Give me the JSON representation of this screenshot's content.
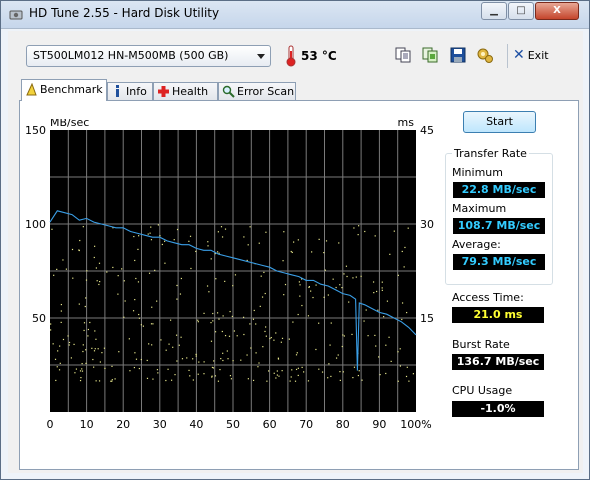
{
  "window": {
    "title": "HD Tune 2.55 - Hard Disk Utility",
    "controls": {
      "minimize": "▁",
      "maximize": "□",
      "close": "X"
    }
  },
  "toolbar": {
    "drive": "ST500LM012 HN-M500MB (500 GB)",
    "temperature": "53 °C",
    "exit_label": "Exit",
    "icons": [
      "copy-text-icon",
      "copy-screenshot-icon",
      "save-icon",
      "options-icon"
    ]
  },
  "tabs": [
    {
      "label": "Benchmark",
      "icon": "benchmark-icon",
      "active": true
    },
    {
      "label": "Info",
      "icon": "info-icon",
      "active": false
    },
    {
      "label": "Health",
      "icon": "health-cross-icon",
      "active": false
    },
    {
      "label": "Error Scan",
      "icon": "magnifier-icon",
      "active": false
    }
  ],
  "panel": {
    "start_label": "Start",
    "transfer_rate": {
      "heading": "Transfer Rate",
      "minimum_label": "Minimum",
      "minimum_value": "22.8 MB/sec",
      "maximum_label": "Maximum",
      "maximum_value": "108.7 MB/sec",
      "average_label": "Average:",
      "average_value": "79.3 MB/sec"
    },
    "access_time_label": "Access Time:",
    "access_time_value": "21.0 ms",
    "burst_rate_label": "Burst Rate",
    "burst_rate_value": "136.7 MB/sec",
    "cpu_usage_label": "CPU Usage",
    "cpu_usage_value": "-1.0%"
  },
  "colors": {
    "plot_bg": "#000000",
    "grid": "#7a7a7a",
    "transfer_line": "#3a9ee6",
    "access_points": "#e6e68c",
    "value_cyan": "#33ccff",
    "value_yellow": "#ffff33"
  },
  "chart_data": {
    "type": "line",
    "left_axis_unit": "MB/sec",
    "right_axis_unit": "ms",
    "xlim": [
      0,
      100
    ],
    "ylim_left": [
      0,
      150
    ],
    "ylim_right": [
      0,
      45
    ],
    "x_ticks": [
      "0",
      "10",
      "20",
      "30",
      "40",
      "50",
      "60",
      "70",
      "80",
      "90",
      "100%"
    ],
    "y_ticks_left": [
      "50",
      "100",
      "150"
    ],
    "y_ticks_right": [
      "15",
      "30",
      "45"
    ],
    "grid": true,
    "series": [
      {
        "kind": "transfer_rate",
        "x": [
          0,
          2,
          4,
          6,
          8,
          10,
          12,
          14,
          16,
          18,
          20,
          22,
          24,
          26,
          28,
          30,
          32,
          34,
          36,
          38,
          40,
          42,
          44,
          46,
          48,
          50,
          52,
          54,
          56,
          58,
          60,
          62,
          64,
          66,
          68,
          70,
          72,
          74,
          76,
          78,
          80,
          82,
          83.5,
          84,
          84.5,
          86,
          88,
          90,
          92,
          94,
          96,
          98,
          100
        ],
        "y": [
          101,
          107,
          106,
          105,
          102,
          103,
          101,
          100,
          99,
          98,
          98,
          96,
          95,
          94,
          93,
          93,
          91,
          90,
          89,
          89,
          87,
          86,
          86,
          84,
          83,
          82,
          81,
          80,
          79,
          78,
          77,
          75,
          74,
          73,
          72,
          70,
          70,
          68,
          67,
          65,
          63,
          62,
          60,
          22,
          58,
          57,
          55,
          53,
          52,
          50,
          48,
          45,
          41
        ]
      },
      {
        "kind": "access_time_scatter",
        "x_range": [
          0,
          100
        ],
        "y_range_ms": [
          5,
          30
        ]
      }
    ]
  }
}
